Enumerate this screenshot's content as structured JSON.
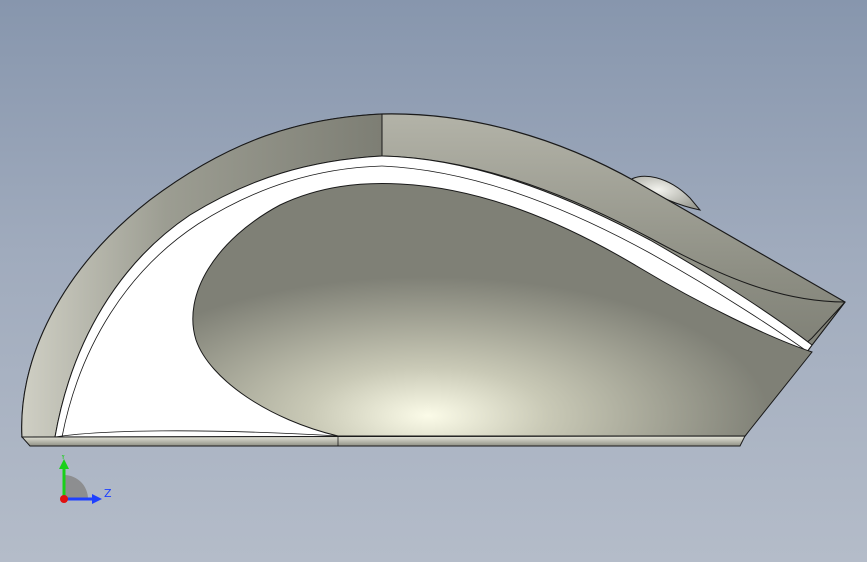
{
  "viewport": {
    "background_top": "#8796ad",
    "background_bottom": "#b4bcc9"
  },
  "model": {
    "name": "computer-mouse-side-view",
    "body_color": "#8e8f84",
    "highlight_color": "#ffffff",
    "edge_color": "#1a1a1a"
  },
  "triad": {
    "y_label": "Y",
    "z_label": "Z",
    "y_color": "#19d019",
    "z_color": "#1e40ff",
    "origin_color": "#e01010"
  }
}
